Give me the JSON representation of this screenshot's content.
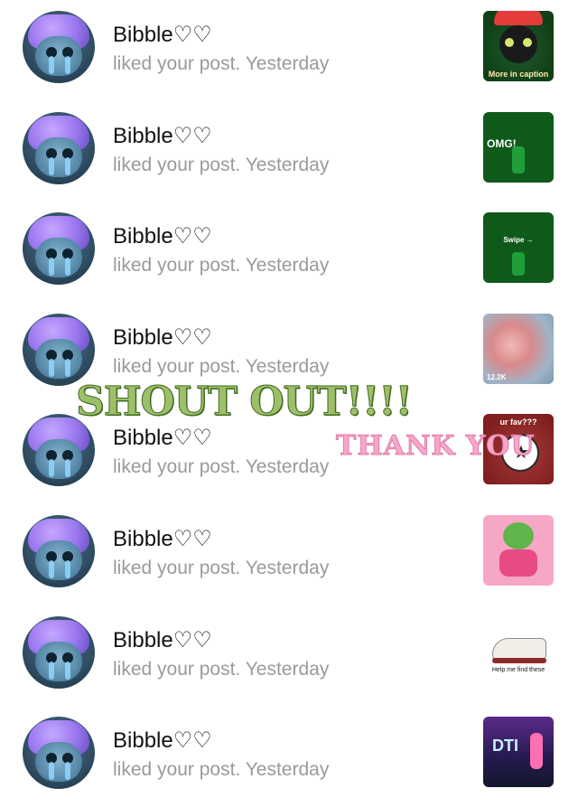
{
  "notifications": [
    {
      "name": "Bibble♡♡",
      "activity": "liked your post. Yesterday",
      "thumb_icon": "christmas-cat",
      "thumb_caption": "More in caption"
    },
    {
      "name": "Bibble♡♡",
      "activity": "liked your post. Yesterday",
      "thumb_icon": "elf-swipe",
      "thumb_caption": "OMG!"
    },
    {
      "name": "Bibble♡♡",
      "activity": "liked your post. Yesterday",
      "thumb_icon": "elf-swipe-2",
      "thumb_caption": "Swipe →"
    },
    {
      "name": "Bibble♡♡",
      "activity": "liked your post. Yesterday",
      "thumb_icon": "blurred-photo",
      "thumb_caption": "12.2K"
    },
    {
      "name": "Bibble♡♡",
      "activity": "liked your post. Yesterday",
      "thumb_icon": "converse-all-star",
      "thumb_caption": "ur fav???"
    },
    {
      "name": "Bibble♡♡",
      "activity": "liked your post. Yesterday",
      "thumb_icon": "grinch",
      "thumb_caption": ""
    },
    {
      "name": "Bibble♡♡",
      "activity": "liked your post. Yesterday",
      "thumb_icon": "converse-shoe",
      "thumb_caption": "Help me find these"
    },
    {
      "name": "Bibble♡♡",
      "activity": "liked your post. Yesterday",
      "thumb_icon": "dti-game",
      "thumb_caption": "DTI"
    }
  ],
  "overlays": {
    "shout_text": "SHOUT OUT!!!!",
    "thank_text": "THANK YOU"
  },
  "colors": {
    "name": "#111111",
    "activity": "#9a9a9a",
    "shout": "#9ebf6a",
    "thank": "#f7a7c9"
  }
}
